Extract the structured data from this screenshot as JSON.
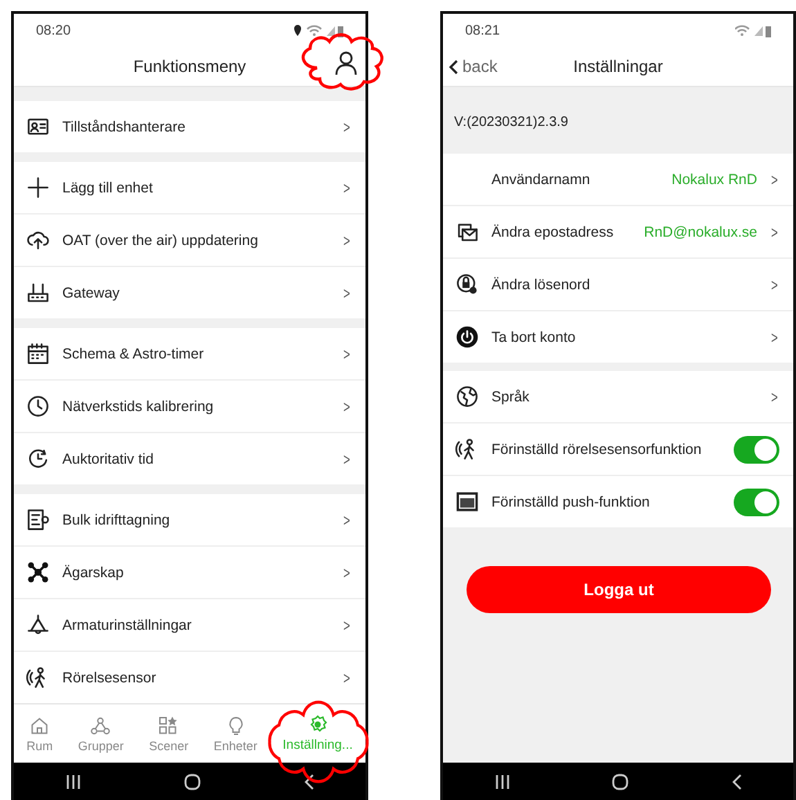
{
  "left_screen": {
    "status_bar": {
      "time": "08:20"
    },
    "header": {
      "title": "Funktionsmeny"
    },
    "menu_groups": [
      [
        {
          "label": "Tillståndshanterare",
          "chevron": ">"
        }
      ],
      [
        {
          "label": "Lägg till enhet",
          "chevron": ">"
        },
        {
          "label": "OAT (over the air) uppdatering",
          "chevron": ">"
        },
        {
          "label": "Gateway",
          "chevron": ">"
        }
      ],
      [
        {
          "label": "Schema & Astro-timer",
          "chevron": ">"
        },
        {
          "label": "Nätverkstids kalibrering",
          "chevron": ">"
        },
        {
          "label": "Auktoritativ tid",
          "chevron": ">"
        }
      ],
      [
        {
          "label": "Bulk idrifttagning",
          "chevron": ">"
        },
        {
          "label": "Ägarskap",
          "chevron": ">"
        },
        {
          "label": "Armaturinställningar",
          "chevron": ">"
        },
        {
          "label": "Rörelsesensor",
          "chevron": ">"
        }
      ]
    ],
    "tabs": [
      {
        "label": "Rum",
        "selected": false
      },
      {
        "label": "Grupper",
        "selected": false
      },
      {
        "label": "Scener",
        "selected": false
      },
      {
        "label": "Enheter",
        "selected": false
      },
      {
        "label": "Inställning...",
        "selected": true
      }
    ]
  },
  "right_screen": {
    "status_bar": {
      "time": "08:21"
    },
    "header": {
      "back": "back",
      "title": "Inställningar"
    },
    "version": "V:(20230321)2.3.9",
    "settings_groups": [
      [
        {
          "kind": "link",
          "label": "Användarnamn",
          "value": "Nokalux RnD",
          "chevron": ">"
        },
        {
          "kind": "link",
          "label": "Ändra epostadress",
          "value": "RnD@nokalux.se",
          "chevron": ">"
        },
        {
          "kind": "link",
          "label": "Ändra lösenord",
          "chevron": ">"
        },
        {
          "kind": "link",
          "label": "Ta bort konto",
          "chevron": ">"
        }
      ],
      [
        {
          "kind": "link",
          "label": "Språk",
          "chevron": ">"
        },
        {
          "kind": "toggle",
          "label": "Förinställd rörelsesensorfunktion",
          "on": true
        },
        {
          "kind": "toggle",
          "label": "Förinställd push-funktion",
          "on": true
        }
      ]
    ],
    "logout_button": "Logga ut"
  }
}
